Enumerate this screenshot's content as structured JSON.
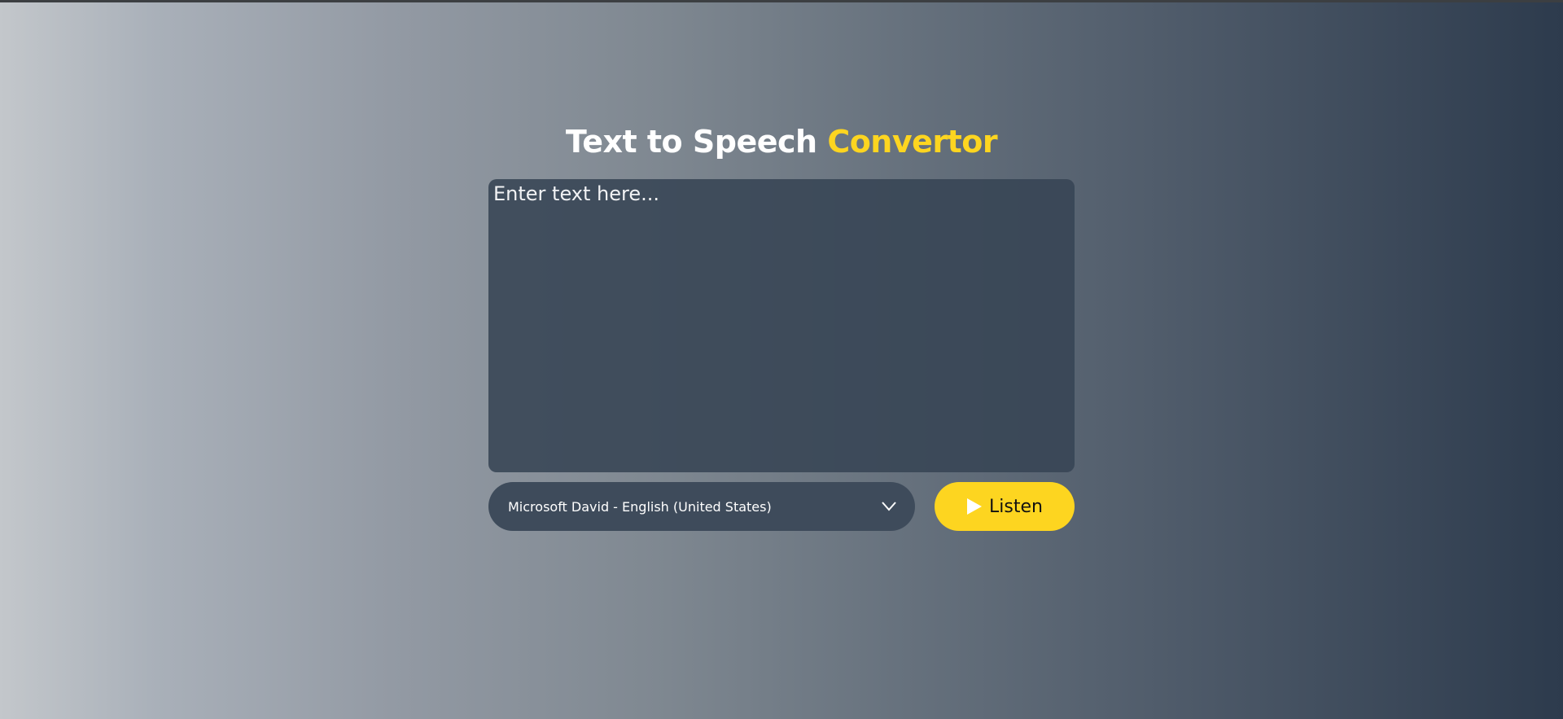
{
  "title": {
    "main": "Text to Speech",
    "accent": "Convertor"
  },
  "textarea": {
    "placeholder": "Enter text here...",
    "value": ""
  },
  "voice_select": {
    "selected": "Microsoft David - English (United States)"
  },
  "listen_button": {
    "label": "Listen"
  },
  "colors": {
    "accent": "#fdd520",
    "panel": "#3e4b5b",
    "title_text": "#ffffff"
  },
  "icons": {
    "dropdown": "chevron-down-icon",
    "listen": "play-icon"
  }
}
